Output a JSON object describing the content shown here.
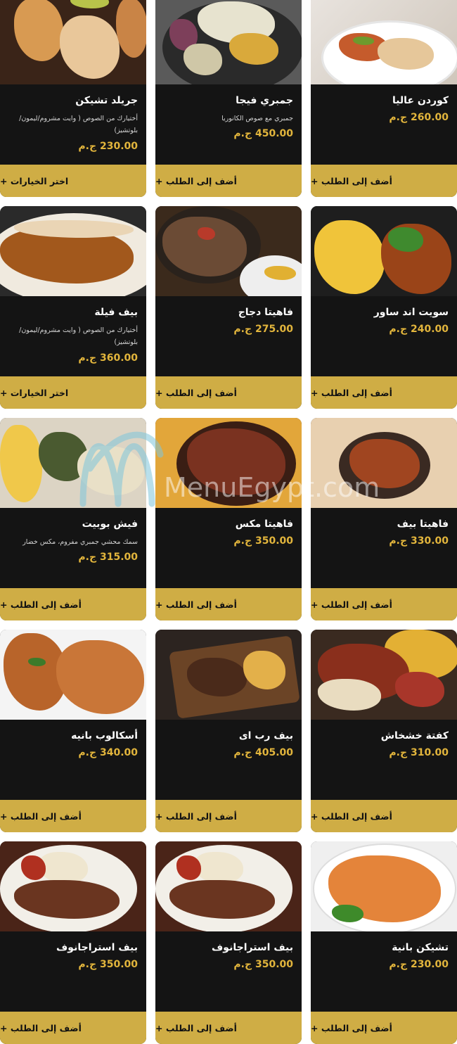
{
  "watermark": "MenuEgypt.com",
  "colors": {
    "card_bg": "#141414",
    "price": "#e2b53c",
    "button_bg": "#cfad45",
    "button_text": "#111111"
  },
  "items": [
    {
      "name": "كوردن عاليا",
      "desc": "",
      "price": "260.00",
      "currency": "ج.م",
      "button": "أضف إلى الطلب +",
      "img": "cordon"
    },
    {
      "name": "جمبري فيجا",
      "desc": "جمبري مع صوص الكانوريا",
      "price": "450.00",
      "currency": "ج.م",
      "button": "أضف إلى الطلب +",
      "img": "shrimp"
    },
    {
      "name": "جريلد تشيكن",
      "desc": "أختيارك من الصوص ( وايت مشروم/ليمون/ بلوتشيز)",
      "price": "230.00",
      "currency": "ج.م",
      "button": "اختر الخيارات +",
      "img": "grilled"
    },
    {
      "name": "سويت اند ساور",
      "desc": "",
      "price": "240.00",
      "currency": "ج.م",
      "button": "أضف إلى الطلب +",
      "img": "sweetsour"
    },
    {
      "name": "فاهيتا دجاج",
      "desc": "",
      "price": "275.00",
      "currency": "ج.م",
      "button": "أضف إلى الطلب +",
      "img": "fajitachicken"
    },
    {
      "name": "بيف فيلة",
      "desc": "أختيارك من الصوص ( وايت مشروم/ليمون/ بلوتشيز)",
      "price": "360.00",
      "currency": "ج.م",
      "button": "اختر الخيارات +",
      "img": "beeffillet"
    },
    {
      "name": "فاهيتا بيف",
      "desc": "",
      "price": "330.00",
      "currency": "ج.م",
      "button": "أضف إلى الطلب +",
      "img": "fajitabeef"
    },
    {
      "name": "فاهيتا مكس",
      "desc": "",
      "price": "350.00",
      "currency": "ج.م",
      "button": "أضف إلى الطلب +",
      "img": "fajitamix"
    },
    {
      "name": "فيش بوبيت",
      "desc": "سمك محشي جمبري مفروم، مكس خضار",
      "price": "315.00",
      "currency": "ج.م",
      "button": "أضف إلى الطلب +",
      "img": "fish"
    },
    {
      "name": "كفتة خشخاش",
      "desc": "",
      "price": "310.00",
      "currency": "ج.م",
      "button": "أضف إلى الطلب +",
      "img": "kofta"
    },
    {
      "name": "بيف رب اى",
      "desc": "",
      "price": "405.00",
      "currency": "ج.م",
      "button": "أضف إلى الطلب +",
      "img": "ribeye"
    },
    {
      "name": "أسكالوب بانيه",
      "desc": "",
      "price": "340.00",
      "currency": "ج.م",
      "button": "أضف إلى الطلب +",
      "img": "escalope"
    },
    {
      "name": "تشيكن بانية",
      "desc": "",
      "price": "230.00",
      "currency": "ج.م",
      "button": "أضف إلى الطلب +",
      "img": "panee"
    },
    {
      "name": "بيف استراجانوف",
      "desc": "",
      "price": "350.00",
      "currency": "ج.م",
      "button": "أضف إلى الطلب +",
      "img": "stroganoff"
    },
    {
      "name": "بيف استراجانوف",
      "desc": "",
      "price": "350.00",
      "currency": "ج.م",
      "button": "أضف إلى الطلب +",
      "img": "stroganoff"
    }
  ]
}
